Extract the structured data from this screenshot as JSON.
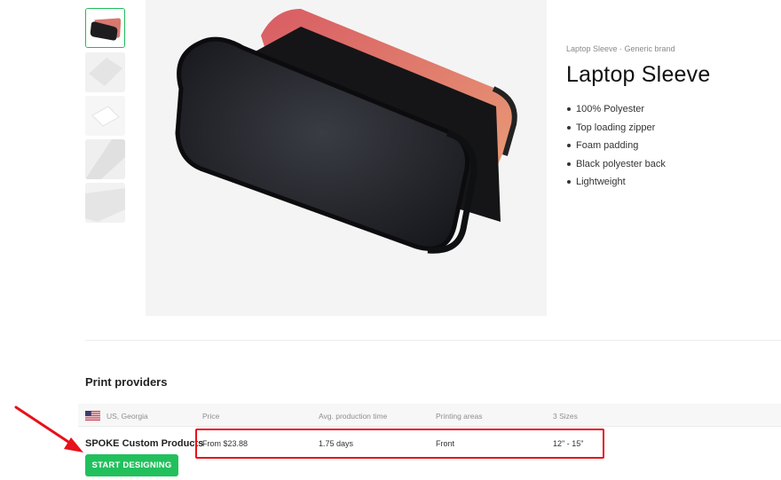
{
  "product": {
    "breadcrumb": "Laptop Sleeve · Generic brand",
    "title": "Laptop Sleeve",
    "features": [
      "100% Polyester",
      "Top loading zipper",
      "Foam padding",
      "Black polyester back",
      "Lightweight"
    ],
    "thumbnail_count": 5,
    "active_thumbnail_index": 0
  },
  "print_providers": {
    "section_title": "Print providers",
    "headers": {
      "location": "US, Georgia",
      "price": "Price",
      "production_time": "Avg. production time",
      "printing_areas": "Printing areas",
      "sizes": "3 Sizes"
    },
    "rows": [
      {
        "provider": "SPOKE Custom Products",
        "price": "From $23.88",
        "production_time": "1.75 days",
        "printing_areas": "Front",
        "sizes": "12\" - 15\""
      }
    ],
    "cta_label": "START DESIGNING"
  },
  "icons": {
    "flag": "us-flag-icon"
  },
  "colors": {
    "accent_green": "#22c05d",
    "annotation_red": "#e8101a"
  }
}
